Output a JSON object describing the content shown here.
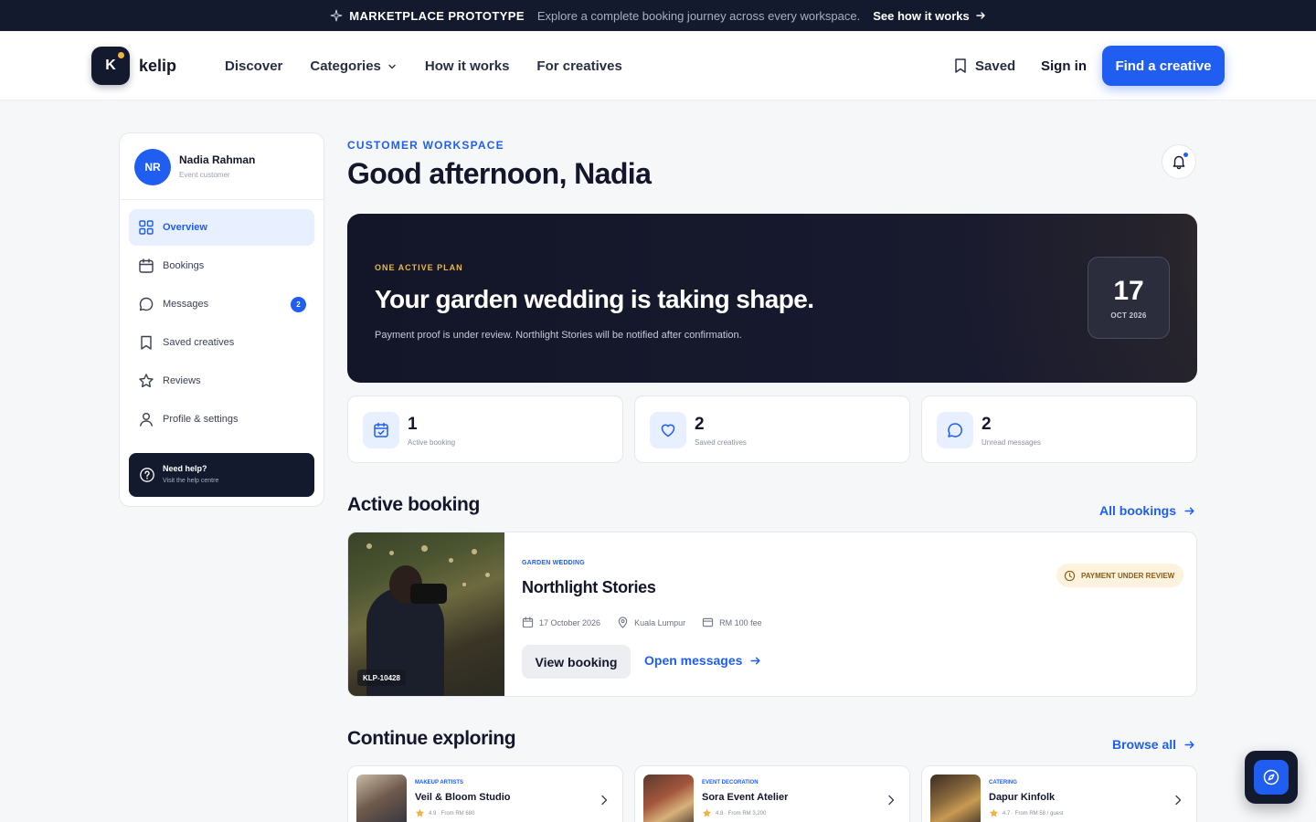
{
  "banner": {
    "tag": "MARKETPLACE PROTOTYPE",
    "description": "Explore a complete booking journey across every workspace.",
    "link": "See how it works"
  },
  "header": {
    "logo_letter": "K",
    "brand": "kelip",
    "nav": [
      "Discover",
      "Categories",
      "How it works",
      "For creatives"
    ],
    "saved": "Saved",
    "sign_in": "Sign in",
    "cta": "Find a creative"
  },
  "sidebar": {
    "avatar_initials": "NR",
    "user_name": "Nadia Rahman",
    "user_role": "Event customer",
    "items": [
      {
        "label": "Overview",
        "icon": "grid-icon"
      },
      {
        "label": "Bookings",
        "icon": "calendar-icon"
      },
      {
        "label": "Messages",
        "icon": "chat-icon",
        "badge": "2"
      },
      {
        "label": "Saved creatives",
        "icon": "bookmark-icon"
      },
      {
        "label": "Reviews",
        "icon": "star-icon"
      },
      {
        "label": "Profile & settings",
        "icon": "user-icon"
      }
    ],
    "help_title": "Need help?",
    "help_subtitle": "Visit the help centre"
  },
  "main": {
    "eyebrow": "CUSTOMER WORKSPACE",
    "greeting": "Good afternoon, Nadia",
    "hero": {
      "tag": "ONE ACTIVE PLAN",
      "headline": "Your garden wedding is taking shape.",
      "note": "Payment proof is under review. Northlight Stories will be notified after confirmation.",
      "day": "17",
      "month": "OCT 2026"
    },
    "stats": [
      {
        "value": "1",
        "label": "Active booking",
        "icon": "calendar-check-icon"
      },
      {
        "value": "2",
        "label": "Saved creatives",
        "icon": "heart-icon"
      },
      {
        "value": "2",
        "label": "Unread messages",
        "icon": "chat-icon"
      }
    ],
    "active_booking": {
      "section_title": "Active booking",
      "all_link": "All bookings",
      "ref": "KLP-10428",
      "category": "GARDEN WEDDING",
      "name": "Northlight Stories",
      "status": "PAYMENT UNDER REVIEW",
      "date": "17 October 2026",
      "location": "Kuala Lumpur",
      "fee": "RM 100 fee",
      "view_button": "View booking",
      "messages_link": "Open messages"
    },
    "explore": {
      "section_title": "Continue exploring",
      "browse_link": "Browse all",
      "cards": [
        {
          "category": "MAKEUP ARTISTS",
          "name": "Veil & Bloom Studio",
          "rating": "4.9 · From RM 680"
        },
        {
          "category": "EVENT DECORATION",
          "name": "Sora Event Atelier",
          "rating": "4.8 · From RM 3,200"
        },
        {
          "category": "CATERING",
          "name": "Dapur Kinfolk",
          "rating": "4.7 · From RM 58 / guest"
        }
      ]
    }
  },
  "colors": {
    "accent": "#1f5ef0",
    "dark": "#141a2e",
    "hero_tag": "#e9b84a",
    "status_bg": "#fdf2dd",
    "status_text": "#8a5b12"
  }
}
